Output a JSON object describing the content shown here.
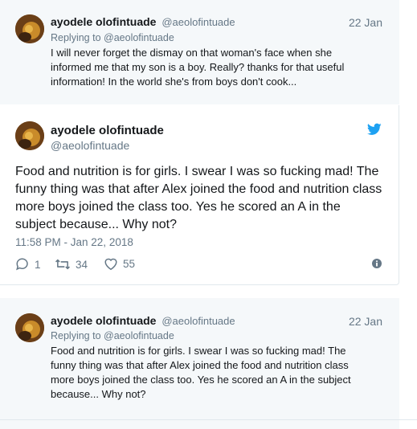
{
  "first_reply": {
    "name": "ayodele olofintuade",
    "handle": "@aeolofintuade",
    "date": "22 Jan",
    "replying_prefix": "Replying to",
    "replying_handle": "@aeolofintuade",
    "line1": "I will never forget the dismay on that woman's face when she",
    "line2": "informed me that my son is a boy. Really? thanks for that useful",
    "line3": "information! In the world she's from boys don't cook..."
  },
  "main_tweet": {
    "name": "ayodele olofintuade",
    "handle": "@aeolofintuade",
    "line1": "Food and nutrition is for girls. I swear I was so fucking mad! The",
    "line2": "funny thing was that after Alex joined the food and nutrition class",
    "line3": "more boys joined the class too. Yes he scored an A in the",
    "line4": "subject because... Why not?",
    "timestamp": "11:58 PM - Jan 22, 2018",
    "reply_count": "1",
    "retweet_count": "34",
    "like_count": "55",
    "icons": [
      "twitter-bird-icon",
      "reply-icon",
      "retweet-icon",
      "heart-icon",
      "info-icon"
    ],
    "accent_color": "#1da1f2"
  },
  "second_reply": {
    "name": "ayodele olofintuade",
    "handle": "@aeolofintuade",
    "date": "22 Jan",
    "replying_prefix": "Replying to",
    "replying_handle": "@aeolofintuade",
    "line1": "Food and nutrition is for girls. I swear I was so fucking mad! The",
    "line2": "funny thing was that after Alex joined the food and nutrition class",
    "line3": "more boys joined the class too. Yes he scored an A in the subject",
    "line4": "because... Why not?"
  }
}
